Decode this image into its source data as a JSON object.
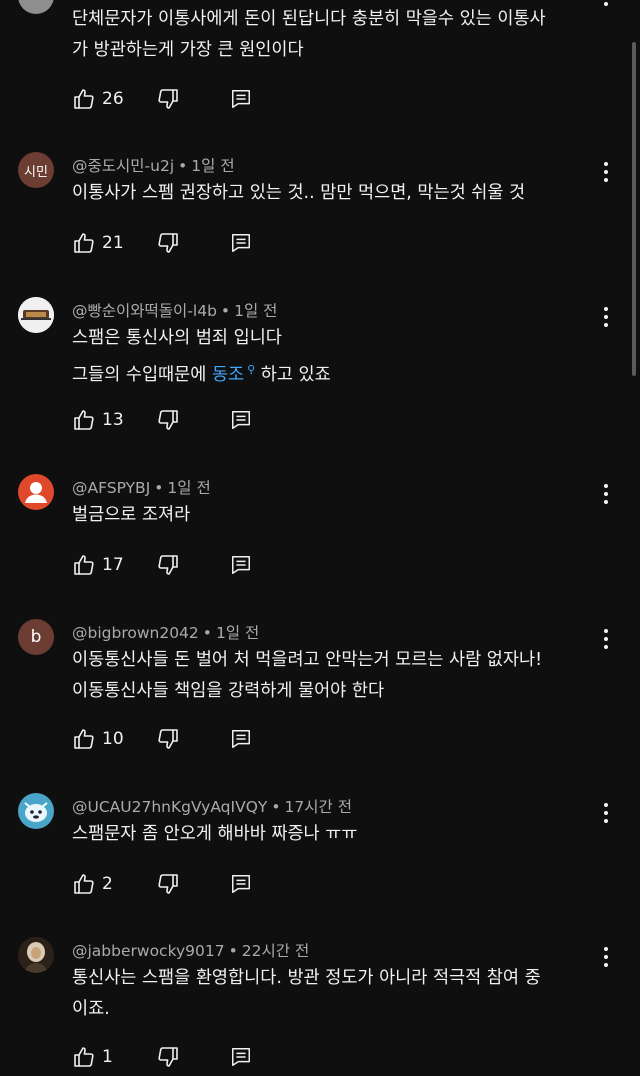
{
  "comments": [
    {
      "handle": "",
      "time": "",
      "lines": [
        "단체문자가 이통사에게 돈이 된답니다 충분히 막을수 있는 이통사",
        "가 방관하는게 가장 큰 원인이다"
      ],
      "likes": "26",
      "avatar": {
        "text": "",
        "color": "#8e8e8e"
      }
    },
    {
      "handle": "@중도시민-u2j",
      "time": "1일 전",
      "lines": [
        "이통사가 스펨 권장하고 있는 것..   맘만 먹으면, 막는것  쉬울 것"
      ],
      "likes": "21",
      "avatar": {
        "text": "시민",
        "color": "#6b3d33"
      }
    },
    {
      "handle": "@빵순이와떡돌이-l4b",
      "time": "1일 전",
      "lines": [
        "스팸은 통신사의 범죄 입니다"
      ],
      "line2_pre": "그들의 수입때문에 ",
      "line2_link": "동조",
      "line2_post": " 하고 있죠",
      "likes": "13",
      "avatar": {
        "text": "",
        "color": "#e8e8e8"
      }
    },
    {
      "handle": "@AFSPYBJ",
      "time": "1일 전",
      "lines": [
        "벌금으로 조져라"
      ],
      "likes": "17",
      "avatar": {
        "text": "",
        "color": "#e0482c"
      }
    },
    {
      "handle": "@bigbrown2042",
      "time": "1일 전",
      "lines": [
        "이동통신사들 돈 벌어 처 먹을려고 안막는거 모르는 사람 없자나!",
        "이동통신사들 책임을 강력하게 물어야 한다"
      ],
      "likes": "10",
      "avatar": {
        "text": "b",
        "color": "#6b3d33"
      }
    },
    {
      "handle": "@UCAU27hnKgVyAqIVQY",
      "time": "17시간 전",
      "lines": [
        "스팸문자 좀 안오게 해바바 짜증나 ㅠㅠ"
      ],
      "likes": "2",
      "avatar": {
        "text": "",
        "color": "#4aa6c8"
      }
    },
    {
      "handle": "@jabberwocky9017",
      "time": "22시간 전",
      "lines": [
        "통신사는 스팸을 환영합니다. 방관 정도가 아니라 적극적 참여 중",
        "이죠."
      ],
      "likes": "1",
      "avatar": {
        "text": "",
        "color": "#3a2a1e"
      }
    }
  ],
  "colors": {
    "background": "#0f0f0f",
    "text": "#f1f1f1",
    "meta": "#aaaaaa",
    "link": "#3ea6ff"
  },
  "icons": {
    "like": "thumb-up-icon",
    "dislike": "thumb-down-icon",
    "reply": "reply-comment-icon",
    "more": "more-vertical-icon",
    "search": "search-icon"
  }
}
